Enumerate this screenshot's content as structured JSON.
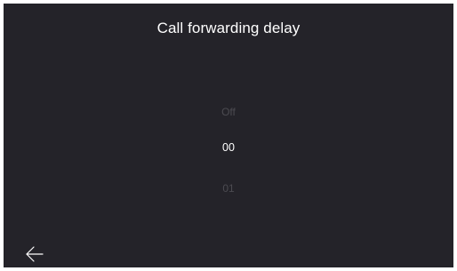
{
  "header": {
    "title": "Call forwarding delay"
  },
  "picker": {
    "previous_option": "Off",
    "selected_option": "00",
    "next_option": "01"
  },
  "navigation": {
    "back_icon": "arrow-left-icon"
  },
  "colors": {
    "background": "#242329",
    "text_primary": "#ffffff",
    "text_dimmed": "#4c4b51"
  }
}
